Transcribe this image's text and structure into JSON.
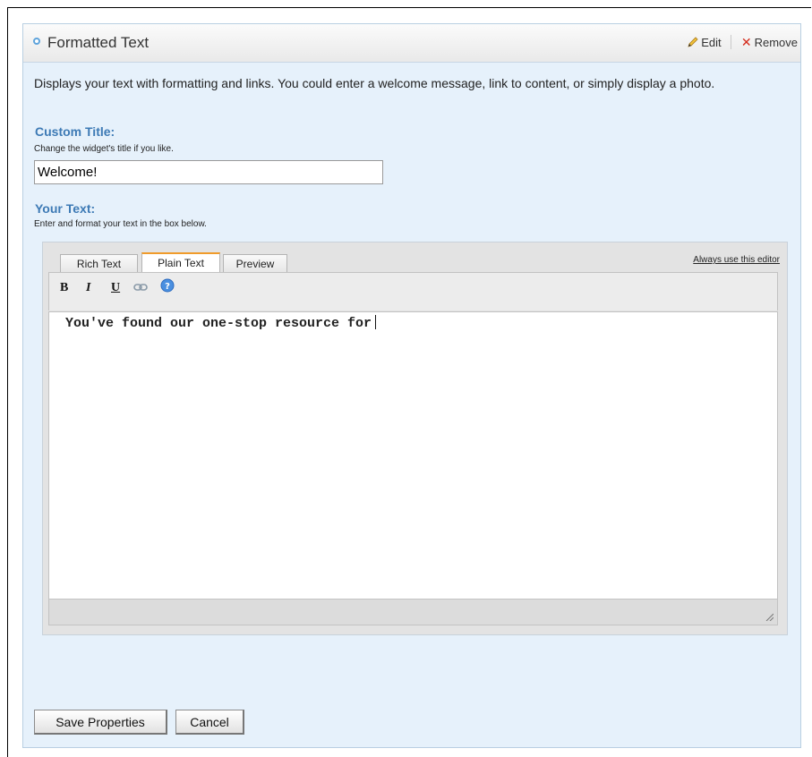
{
  "widget": {
    "title": "Formatted Text",
    "edit_label": "Edit",
    "remove_label": "Remove",
    "description": "Displays your text with formatting and links. You could enter a welcome message, link to content, or simply display a photo."
  },
  "custom_title": {
    "label": "Custom Title:",
    "hint": "Change the widget's title if you like.",
    "value": "Welcome!"
  },
  "your_text": {
    "label": "Your Text:",
    "hint": "Enter and format your text in the box below."
  },
  "editor": {
    "tabs": [
      {
        "label": "Rich Text",
        "active": false
      },
      {
        "label": "Plain Text",
        "active": true
      },
      {
        "label": "Preview",
        "active": false
      }
    ],
    "always_use_label": "Always use this editor",
    "toolbar": {
      "bold": "B",
      "italic": "I",
      "underline": "U"
    },
    "content": "You've found our one-stop resource for"
  },
  "buttons": {
    "save": "Save Properties",
    "cancel": "Cancel"
  },
  "colors": {
    "accent_blue": "#3d7ab5",
    "panel_bg": "#e6f1fb",
    "tab_active_border": "#f09b2a",
    "remove_red": "#d42a1a"
  },
  "icons": [
    "pencil-icon",
    "remove-x-icon",
    "link-icon",
    "help-icon",
    "collapse-bullet-icon",
    "resize-handle-icon"
  ]
}
